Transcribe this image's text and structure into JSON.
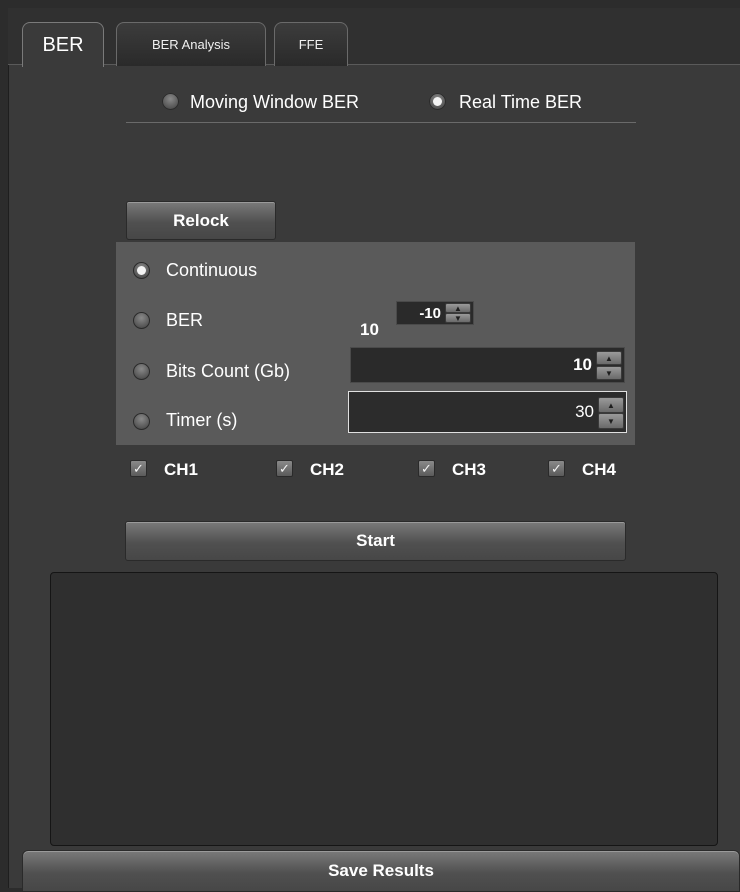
{
  "tabs": [
    {
      "label": "BER",
      "active": true
    },
    {
      "label": "BER Analysis",
      "active": false
    },
    {
      "label": "FFE",
      "active": false
    }
  ],
  "mode": {
    "options": [
      {
        "label": "Moving Window BER",
        "selected": false
      },
      {
        "label": "Real Time BER",
        "selected": true
      }
    ]
  },
  "relock_label": "Relock",
  "criteria": {
    "options": [
      {
        "label": "Continuous",
        "selected": true
      },
      {
        "label": "BER",
        "selected": false
      },
      {
        "label": "Bits Count (Gb)",
        "selected": false
      },
      {
        "label": "Timer (s)",
        "selected": false
      }
    ],
    "ber_base": "10",
    "ber_exponent": "-10",
    "bits_count": "10",
    "timer": "30"
  },
  "channels": [
    {
      "label": "CH1",
      "checked": true
    },
    {
      "label": "CH2",
      "checked": true
    },
    {
      "label": "CH3",
      "checked": true
    },
    {
      "label": "CH4",
      "checked": true
    }
  ],
  "start_label": "Start",
  "save_label": "Save Results",
  "icons": {
    "check": "checkmark-icon",
    "spin_up": "chevron-up-icon",
    "spin_down": "chevron-down-icon"
  },
  "colors": {
    "panel_bg": "#3a3a3a",
    "group_bg": "#5a5a5a",
    "field_bg": "#2e2e2e",
    "results_bg": "#2f2f2f"
  }
}
